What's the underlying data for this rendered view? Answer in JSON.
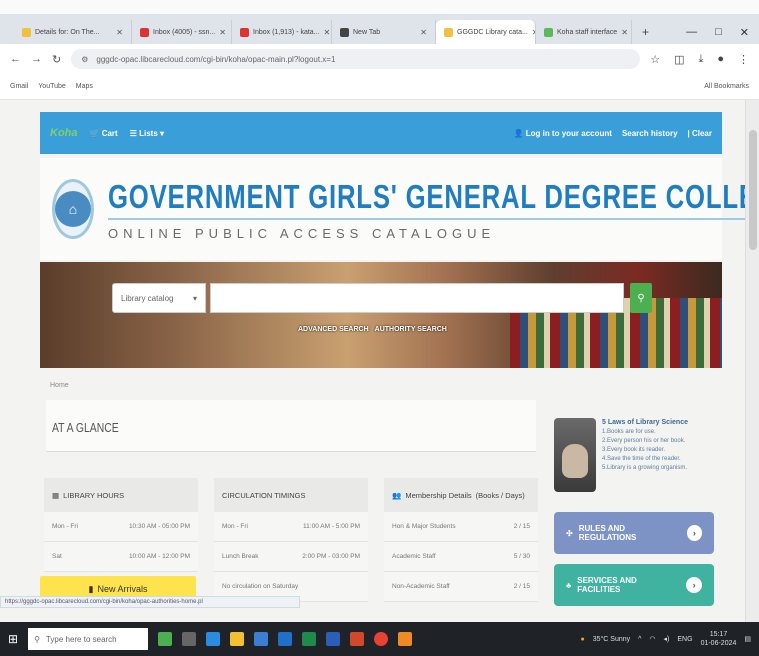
{
  "browser": {
    "tabs": [
      {
        "label": "Details for: On The...",
        "color": "#f0c040"
      },
      {
        "label": "Inbox (4005) - ssn...",
        "color": "#d33"
      },
      {
        "label": "Inbox (1,913) - kata...",
        "color": "#d33"
      },
      {
        "label": "New Tab",
        "color": "#444"
      },
      {
        "label": "GGGDC Library cata...",
        "color": "#f0c040",
        "active": true
      },
      {
        "label": "Koha staff interface",
        "color": "#5cb85c"
      }
    ],
    "new_tab": "+",
    "win_controls": [
      "—",
      "□",
      "✕"
    ],
    "url": "gggdc-opac.libcarecloud.com/cgi-bin/koha/opac-main.pl?logout.x=1",
    "bookmarks": [
      "Gmail",
      "YouTube",
      "Maps"
    ],
    "all_bookmarks": "All Bookmarks",
    "status_url": "https://gggdc-opac.libcarecloud.com/cgi-bin/koha/opac-authorities-home.pl"
  },
  "site": {
    "koha": "Koha",
    "cart": "Cart",
    "lists": "Lists",
    "login": "Log in to your account",
    "search_history": "Search history",
    "clear": "Clear",
    "college_name": "GOVERNMENT GIRLS' GENERAL DEGREE COLLEGE",
    "subtitle": "ONLINE PUBLIC ACCESS CATALOGUE",
    "search_select": "Library catalog",
    "search_placeholder": "",
    "advanced_search": "ADVANCED SEARCH",
    "authority_search": "AUTHORITY SEARCH",
    "breadcrumb": "Home",
    "at_a_glance": "AT A GLANCE"
  },
  "library_hours": {
    "title": "LIBRARY HOURS",
    "rows": [
      {
        "day": "Mon - Fri",
        "time": "10:30 AM - 05:00 PM"
      },
      {
        "day": "Sat",
        "time": "10:00 AM - 12:00 PM"
      }
    ]
  },
  "circulation": {
    "title": "CIRCULATION TIMINGS",
    "rows": [
      {
        "day": "Mon - Fri",
        "time": "11:00 AM - 5:00 PM"
      },
      {
        "day": "Lunch Break",
        "time": "2:00 PM - 03:00 PM"
      },
      {
        "day": "No circulation on Saturday",
        "time": ""
      }
    ]
  },
  "membership": {
    "title": "Membership Details",
    "subtitle": "(Books / Days)",
    "rows": [
      {
        "who": "Hon & Major Students",
        "val": "2 / 15"
      },
      {
        "who": "Academic Staff",
        "val": "5 / 30"
      },
      {
        "who": "Non-Academic Staff",
        "val": "2 / 15"
      }
    ]
  },
  "new_arrivals": "New Arrivals",
  "laws": {
    "title": "5 Laws of Library Science",
    "items": [
      "1.Books are for use.",
      "2.Every person his or her book.",
      "3.Every book its reader.",
      "4.Save the time of the reader.",
      "5.Library is a growing organism."
    ]
  },
  "side_buttons": [
    "RULES AND REGULATIONS",
    "SERVICES AND FACILITIES"
  ],
  "taskbar": {
    "search_placeholder": "Type here to search",
    "weather": "35°C Sunny",
    "lang": "ENG",
    "time": "15:17",
    "date": "01-06-2024"
  }
}
